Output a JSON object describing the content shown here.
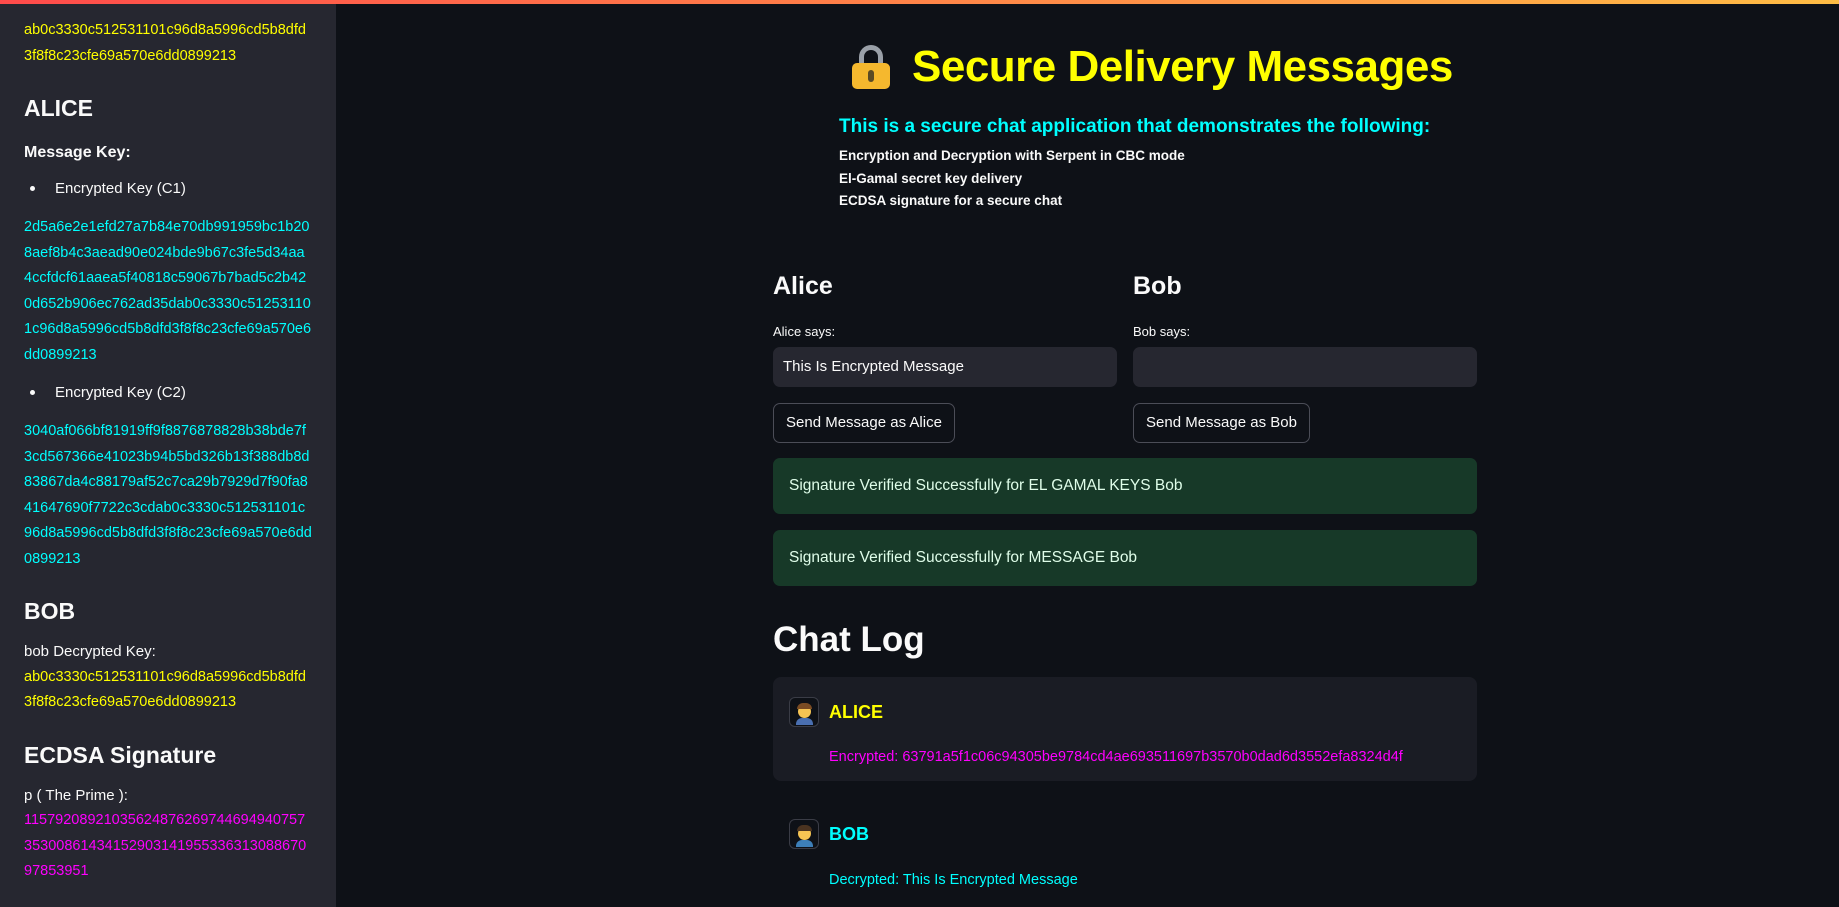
{
  "sidebar": {
    "top_hex": "ab0c3330c512531101c96d8a5996cd5b8dfd3f8f8c23cfe69a570e6dd0899213",
    "alice_heading": "ALICE",
    "message_key_label": "Message Key:",
    "c1_label": "Encrypted Key (C1)",
    "c1_value": "2d5a6e2e1efd27a7b84e70db991959bc1b208aef8b4c3aead90e024bde9b67c3fe5d34aa4ccfdcf61aaea5f40818c59067b7bad5c2b420d652b906ec762ad35dab0c3330c512531101c96d8a5996cd5b8dfd3f8f8c23cfe69a570e6dd0899213",
    "c2_label": "Encrypted Key (C2)",
    "c2_value": "3040af066bf81919ff9f8876878828b38bde7f3cd567366e41023b94b5bd326b13f388db8d83867da4c88179af52c7ca29b7929d7f90fa841647690f7722c3cdab0c3330c512531101c96d8a5996cd5b8dfd3f8f8c23cfe69a570e6dd0899213",
    "bob_heading": "BOB",
    "bob_key_label": "bob Decrypted Key:",
    "bob_key_value": "ab0c3330c512531101c96d8a5996cd5b8dfd3f8f8c23cfe69a570e6dd0899213",
    "ecdsa_heading": "ECDSA Signature",
    "prime_label": "p ( The Prime ):",
    "prime_value": "115792089210356248762697446949407573530086143415290314195533631308867097853951"
  },
  "header": {
    "title": "Secure Delivery Messages",
    "lock_icon": "lock-icon",
    "subtitle": "This is a secure chat application that demonstrates the following:",
    "features": [
      "Encryption and Decryption with Serpent in CBC mode",
      "El-Gamal secret key delivery",
      "ECDSA signature for a secure chat"
    ]
  },
  "alice": {
    "heading": "Alice",
    "input_label": "Alice says:",
    "input_value": "This Is Encrypted Message",
    "send_label": "Send Message as Alice"
  },
  "bob": {
    "heading": "Bob",
    "input_label": "Bob says:",
    "input_value": "",
    "send_label": "Send Message as Bob"
  },
  "alerts": [
    "Signature Verified Successfully for EL GAMAL KEYS Bob",
    "Signature Verified Successfully for MESSAGE Bob"
  ],
  "chat": {
    "heading": "Chat Log",
    "messages": [
      {
        "sender": "ALICE",
        "text": "Encrypted: 63791a5f1c06c94305be9784cd4ae693511697b3570b0dad6d3552efa8324d4f"
      },
      {
        "sender": "BOB",
        "text": "Decrypted: This Is Encrypted Message"
      }
    ]
  },
  "colors": {
    "yellow": "#ffff00",
    "cyan": "#00ffff",
    "magenta": "#ff00ff",
    "success_bg": "#173928",
    "sidebar_bg": "#262730",
    "main_bg": "#0e1117"
  }
}
